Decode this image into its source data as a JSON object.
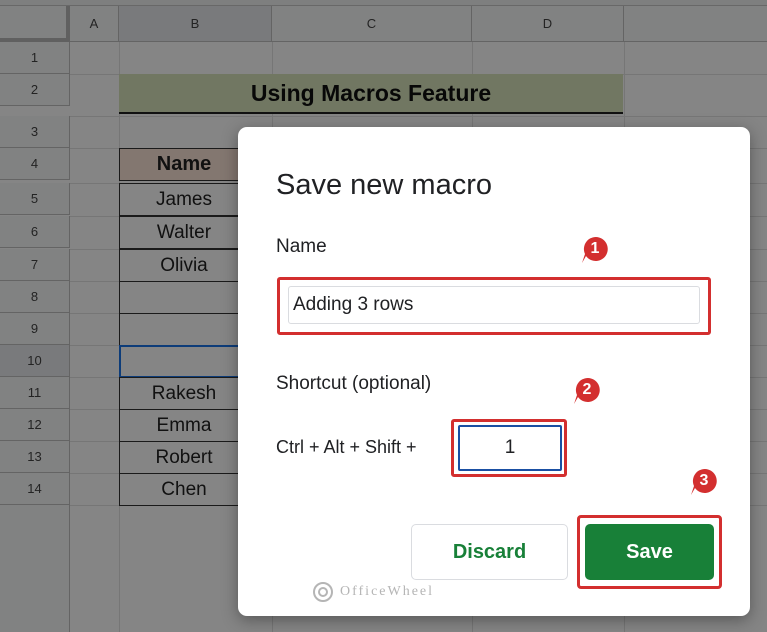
{
  "sheet": {
    "columns": [
      "A",
      "B",
      "C",
      "D"
    ],
    "rows": [
      "1",
      "2",
      "3",
      "4",
      "5",
      "6",
      "7",
      "8",
      "9",
      "10",
      "11",
      "12",
      "13",
      "14"
    ],
    "title": "Using Macros Feature",
    "table": {
      "header": "Name",
      "names": [
        "James",
        "Walter",
        "Olivia",
        "",
        "",
        "",
        "Rakesh",
        "Emma",
        "Robert",
        "Chen"
      ]
    }
  },
  "dialog": {
    "title": "Save new macro",
    "name_label": "Name",
    "name_value": "Adding 3 rows",
    "shortcut_label": "Shortcut (optional)",
    "shortcut_prefix": "Ctrl + Alt + Shift +",
    "shortcut_value": "1",
    "discard_label": "Discard",
    "save_label": "Save"
  },
  "markers": [
    "1",
    "2",
    "3"
  ],
  "watermark": "OfficeWheel",
  "colors": {
    "title_fill": "#d8e4bc",
    "header_fill": "#fce4d6",
    "save_button": "#188038",
    "highlight": "#d32f2f",
    "selection": "#1a73e8"
  }
}
